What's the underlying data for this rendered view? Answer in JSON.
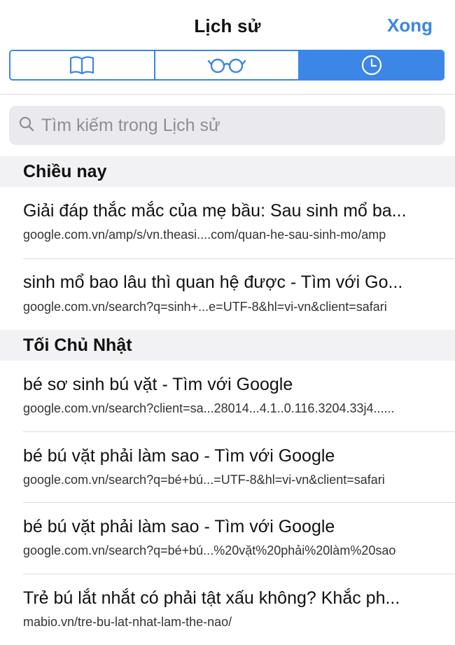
{
  "navbar": {
    "title": "Lịch sử",
    "done_label": "Xong"
  },
  "segments": [
    {
      "icon": "book-icon",
      "active": false
    },
    {
      "icon": "glasses-icon",
      "active": false
    },
    {
      "icon": "clock-icon",
      "active": true
    }
  ],
  "colors": {
    "accent": "#3b86e6",
    "section_bg": "#f2f2f4",
    "search_bg": "#e9e9ee"
  },
  "search": {
    "placeholder": "Tìm kiếm trong Lịch sử",
    "value": ""
  },
  "sections": [
    {
      "header": "Chiều nay",
      "items": [
        {
          "title": "Giải đáp thắc mắc của mẹ bầu: Sau sinh mổ ba...",
          "url": "google.com.vn/amp/s/vn.theasi....com/quan-he-sau-sinh-mo/amp"
        },
        {
          "title": "sinh mổ bao lâu thì quan hệ được - Tìm với Go...",
          "url": "google.com.vn/search?q=sinh+...e=UTF-8&hl=vi-vn&client=safari"
        }
      ]
    },
    {
      "header": "Tối Chủ Nhật",
      "items": [
        {
          "title": "bé sơ sinh bú vặt - Tìm với Google",
          "url": "google.com.vn/search?client=sa...28014...4.1..0.116.3204.33j4......"
        },
        {
          "title": "bé bú vặt phải làm sao - Tìm với Google",
          "url": "google.com.vn/search?q=bé+bú...=UTF-8&hl=vi-vn&client=safari"
        },
        {
          "title": "bé bú vặt phải làm sao - Tìm với Google",
          "url": "google.com.vn/search?q=bé+bú...%20vặt%20phải%20làm%20sao"
        },
        {
          "title": "Trẻ bú lắt nhắt có phải tật xấu không? Khắc ph...",
          "url": "mabio.vn/tre-bu-lat-nhat-lam-the-nao/"
        }
      ]
    }
  ]
}
